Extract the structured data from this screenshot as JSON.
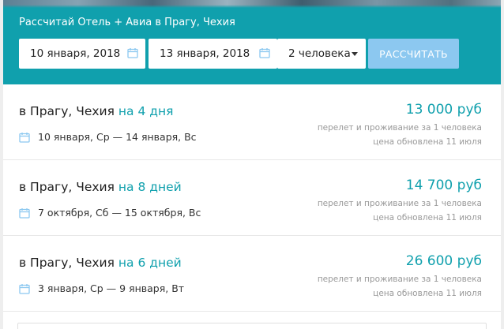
{
  "search": {
    "title": "Рассчитай Отель + Авиа в Прагу, Чехия",
    "date_from": "10 января, 2018",
    "date_to": "13 января, 2018",
    "persons": "2 человека",
    "submit_label": "РАССЧИТАТЬ"
  },
  "results": [
    {
      "destination": "в Прагу, Чехия ",
      "duration": "на 4 дня",
      "dates": "10 января, Ср — 14 января, Вс",
      "price": "13 000 руб",
      "note": "перелет и проживание за 1 человека",
      "updated": "цена обновлена 11 июля"
    },
    {
      "destination": "в Прагу, Чехия ",
      "duration": "на 8 дней",
      "dates": "7 октября, Сб — 15 октября, Вс",
      "price": "14 700 руб",
      "note": "перелет и проживание за 1 человека",
      "updated": "цена обновлена 11 июля"
    },
    {
      "destination": "в Прагу, Чехия ",
      "duration": "на 6 дней",
      "dates": "3 января, Ср — 9 января, Вт",
      "price": "26 600 руб",
      "note": "перелет и проживание за 1 человека",
      "updated": "цена обновлена 11 июля"
    }
  ],
  "icons": {
    "calendar": "calendar-icon",
    "dropdown": "caret-down-icon"
  },
  "colors": {
    "accent": "#10a0ad",
    "button": "#8cc8f0",
    "calendar_icon": "#8cc8f0"
  }
}
